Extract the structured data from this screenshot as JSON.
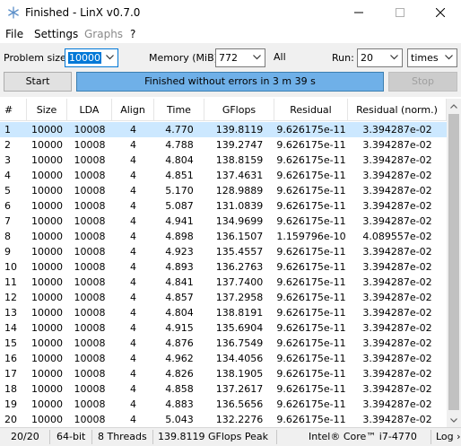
{
  "window": {
    "title": "Finished - LinX v0.7.0"
  },
  "menu": {
    "file": "File",
    "settings": "Settings",
    "graphs": "Graphs",
    "help": "?"
  },
  "controls": {
    "problem_size_label": "Problem size:",
    "problem_size_value": "10000",
    "memory_label": "Memory (MiB):",
    "memory_value": "772",
    "all_label": "All",
    "run_label": "Run:",
    "run_value": "20",
    "run_unit": "times",
    "start_label": "Start",
    "stop_label": "Stop",
    "progress_text": "Finished without errors in 3 m 39 s",
    "progress_fraction": 1.0
  },
  "table": {
    "columns": [
      "#",
      "Size",
      "LDA",
      "Align",
      "Time",
      "GFlops",
      "Residual",
      "Residual (norm.)"
    ],
    "rows": [
      [
        "1",
        "10000",
        "10008",
        "4",
        "4.770",
        "139.8119",
        "9.626175e-11",
        "3.394287e-02"
      ],
      [
        "2",
        "10000",
        "10008",
        "4",
        "4.788",
        "139.2747",
        "9.626175e-11",
        "3.394287e-02"
      ],
      [
        "3",
        "10000",
        "10008",
        "4",
        "4.804",
        "138.8159",
        "9.626175e-11",
        "3.394287e-02"
      ],
      [
        "4",
        "10000",
        "10008",
        "4",
        "4.851",
        "137.4631",
        "9.626175e-11",
        "3.394287e-02"
      ],
      [
        "5",
        "10000",
        "10008",
        "4",
        "5.170",
        "128.9889",
        "9.626175e-11",
        "3.394287e-02"
      ],
      [
        "6",
        "10000",
        "10008",
        "4",
        "5.087",
        "131.0839",
        "9.626175e-11",
        "3.394287e-02"
      ],
      [
        "7",
        "10000",
        "10008",
        "4",
        "4.941",
        "134.9699",
        "9.626175e-11",
        "3.394287e-02"
      ],
      [
        "8",
        "10000",
        "10008",
        "4",
        "4.898",
        "136.1507",
        "1.159796e-10",
        "4.089557e-02"
      ],
      [
        "9",
        "10000",
        "10008",
        "4",
        "4.923",
        "135.4557",
        "9.626175e-11",
        "3.394287e-02"
      ],
      [
        "10",
        "10000",
        "10008",
        "4",
        "4.893",
        "136.2763",
        "9.626175e-11",
        "3.394287e-02"
      ],
      [
        "11",
        "10000",
        "10008",
        "4",
        "4.841",
        "137.7400",
        "9.626175e-11",
        "3.394287e-02"
      ],
      [
        "12",
        "10000",
        "10008",
        "4",
        "4.857",
        "137.2958",
        "9.626175e-11",
        "3.394287e-02"
      ],
      [
        "13",
        "10000",
        "10008",
        "4",
        "4.804",
        "138.8191",
        "9.626175e-11",
        "3.394287e-02"
      ],
      [
        "14",
        "10000",
        "10008",
        "4",
        "4.915",
        "135.6904",
        "9.626175e-11",
        "3.394287e-02"
      ],
      [
        "15",
        "10000",
        "10008",
        "4",
        "4.876",
        "136.7549",
        "9.626175e-11",
        "3.394287e-02"
      ],
      [
        "16",
        "10000",
        "10008",
        "4",
        "4.962",
        "134.4056",
        "9.626175e-11",
        "3.394287e-02"
      ],
      [
        "17",
        "10000",
        "10008",
        "4",
        "4.826",
        "138.1905",
        "9.626175e-11",
        "3.394287e-02"
      ],
      [
        "18",
        "10000",
        "10008",
        "4",
        "4.858",
        "137.2617",
        "9.626175e-11",
        "3.394287e-02"
      ],
      [
        "19",
        "10000",
        "10008",
        "4",
        "4.883",
        "136.5656",
        "9.626175e-11",
        "3.394287e-02"
      ],
      [
        "20",
        "10000",
        "10008",
        "4",
        "5.043",
        "132.2276",
        "9.626175e-11",
        "3.394287e-02"
      ]
    ],
    "selected_row": 0
  },
  "status": {
    "runs": "20/20",
    "arch": "64-bit",
    "threads": "8 Threads",
    "peak": "139.8119 GFlops Peak",
    "cpu": "Intel® Core™ i7-4770",
    "log": "Log ›"
  },
  "colors": {
    "selection": "#cce8ff",
    "progress_fill": "#6fb0e8",
    "focus_accent": "#0078d7"
  },
  "icons": {
    "app": "linx-snowflake-icon",
    "min": "minimize-icon",
    "max": "maximize-icon",
    "close": "close-icon",
    "dropdown": "chevron-down-icon"
  }
}
